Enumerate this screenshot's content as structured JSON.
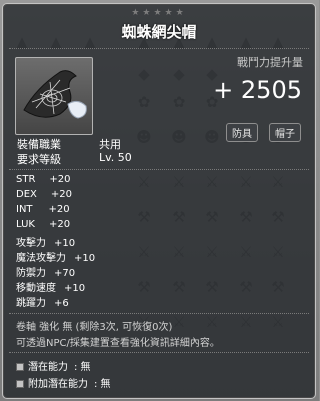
{
  "item": {
    "stars": "★★★★★",
    "name": "蜘蛛網尖帽",
    "power_label": "戰鬥力提升量",
    "power_value": "+ 2505",
    "tags": [
      "防具",
      "帽子"
    ],
    "job_label": "裝備職業",
    "job_value": "共用",
    "level_label": "要求等級",
    "level_value": "Lv. 50"
  },
  "stats": [
    {
      "key": "STR",
      "value": "+20"
    },
    {
      "key": "DEX",
      "value": "+20"
    },
    {
      "key": "INT",
      "value": "+20"
    },
    {
      "key": "LUK",
      "value": "+20"
    },
    {
      "key": "攻擊力",
      "value": "+10"
    },
    {
      "key": "魔法攻擊力",
      "value": "+10"
    },
    {
      "key": "防禦力",
      "value": "+70"
    },
    {
      "key": "移動速度",
      "value": "+10"
    },
    {
      "key": "跳躍力",
      "value": "+6"
    }
  ],
  "footer": {
    "enhance": "卷軸 強化 無 (剩除3次, 可恢復0次)",
    "note": "可透過NPC/採集建置查看強化資訊詳細內容。"
  },
  "potentials": [
    {
      "label": "潛在能力",
      "value": ": 無"
    },
    {
      "label": "附加潛在能力",
      "value": ": 無"
    }
  ],
  "colors": {
    "panel": "#202428",
    "border": "#c4c4c4",
    "stars": "#7c7c7c"
  },
  "icons": {
    "item": "spider-web-hat-icon",
    "background": "inventory-item-icons"
  }
}
